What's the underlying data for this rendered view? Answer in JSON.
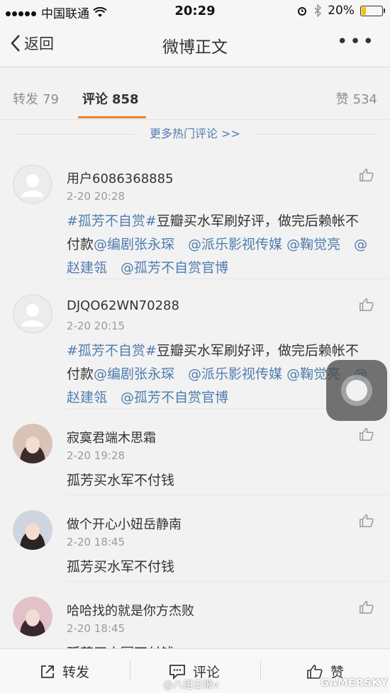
{
  "status_bar": {
    "carrier": "中国联通",
    "time": "20:29",
    "battery": "20%",
    "battery_level": 0.2
  },
  "nav": {
    "back_label": "返回",
    "title": "微博正文",
    "more_label": "•••"
  },
  "tabs": {
    "repost": {
      "label": "转发",
      "count": "79"
    },
    "comment": {
      "label": "评论",
      "count": "858"
    },
    "like": {
      "label": "赞",
      "count": "534"
    }
  },
  "more_hot_link": "更多热门评论 >>",
  "comments": [
    {
      "name": "用户6086368885",
      "time": "2-20 20:28",
      "parts": [
        {
          "t": "#孤芳不自赏#",
          "link": true
        },
        {
          "t": "豆瓣买水军刷好评，做完后赖帐不付款",
          "link": false
        },
        {
          "t": "@编剧张永琛",
          "link": true
        },
        {
          "t": "　",
          "link": false
        },
        {
          "t": "@派乐影视传媒",
          "link": true
        },
        {
          "t": " ",
          "link": false
        },
        {
          "t": "@鞠觉亮",
          "link": true
        },
        {
          "t": "　",
          "link": false
        },
        {
          "t": "@赵建瓴",
          "link": true
        },
        {
          "t": "　",
          "link": false
        },
        {
          "t": "@孤芳不自赏官博",
          "link": true
        }
      ]
    },
    {
      "name": "DJQO62WN70288",
      "time": "2-20 20:15",
      "parts": [
        {
          "t": "#孤芳不自赏#",
          "link": true
        },
        {
          "t": "豆瓣买水军刷好评，做完后赖帐不付款",
          "link": false
        },
        {
          "t": "@编剧张永琛",
          "link": true
        },
        {
          "t": "　",
          "link": false
        },
        {
          "t": "@派乐影视传媒",
          "link": true
        },
        {
          "t": " ",
          "link": false
        },
        {
          "t": "@鞠觉亮",
          "link": true
        },
        {
          "t": "　",
          "link": false
        },
        {
          "t": "@赵建瓴",
          "link": true
        },
        {
          "t": "　",
          "link": false
        },
        {
          "t": "@孤芳不自赏官博",
          "link": true
        }
      ]
    },
    {
      "name": "寂寞君端木思霜",
      "time": "2-20 19:28",
      "parts": [
        {
          "t": "孤芳买水军不付钱",
          "link": false
        }
      ]
    },
    {
      "name": "做个开心小妞岳静南",
      "time": "2-20 18:45",
      "parts": [
        {
          "t": "孤芳买水军不付钱",
          "link": false
        }
      ]
    },
    {
      "name": "哈哈找的就是你方杰败",
      "time": "2-20 18:45",
      "parts": [
        {
          "t": "孤芳买水军不付钱",
          "link": false
        }
      ]
    }
  ],
  "toolbar": {
    "repost": "转发",
    "comment": "评论",
    "like": "赞"
  },
  "watermarks": {
    "left": "@八组日报v",
    "right": "GAMERSKY"
  },
  "colors": {
    "accent": "#f08224",
    "link": "#507daf"
  }
}
